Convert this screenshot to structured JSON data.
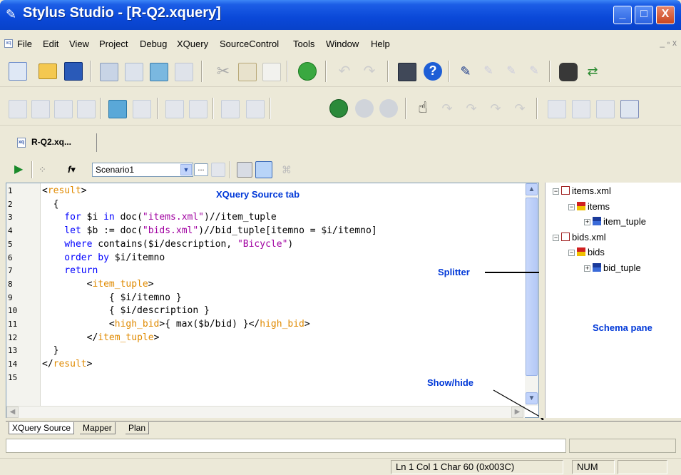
{
  "window": {
    "title": "Stylus Studio - [R-Q2.xquery]",
    "minimize": "_",
    "maximize": "□",
    "close": "X"
  },
  "menu": [
    "File",
    "Edit",
    "View",
    "Project",
    "Debug",
    "XQuery",
    "SourceControl",
    "Tools",
    "Window",
    "Help"
  ],
  "mdi_controls": "_ ▫ x",
  "doc_tab": {
    "label": "R-Q2.xq..."
  },
  "query_toolbar": {
    "scenario": "Scenario1",
    "browse": "..."
  },
  "editor": {
    "line_numbers": [
      "1",
      "2",
      "3",
      "4",
      "5",
      "6",
      "7",
      "8",
      "9",
      "10",
      "11",
      "12",
      "13",
      "14",
      "15"
    ],
    "lines": [
      [
        {
          "t": "<",
          "c": "plain"
        },
        {
          "t": "result",
          "c": "tag"
        },
        {
          "t": ">",
          "c": "plain"
        }
      ],
      [
        {
          "t": "  {",
          "c": "plain"
        }
      ],
      [
        {
          "t": "    for ",
          "c": "kw"
        },
        {
          "t": "$i ",
          "c": "plain"
        },
        {
          "t": "in ",
          "c": "kw"
        },
        {
          "t": "doc(",
          "c": "plain"
        },
        {
          "t": "\"items.xml\"",
          "c": "str"
        },
        {
          "t": ")//item_tuple",
          "c": "plain"
        }
      ],
      [
        {
          "t": "    let ",
          "c": "kw"
        },
        {
          "t": "$b := doc(",
          "c": "plain"
        },
        {
          "t": "\"bids.xml\"",
          "c": "str"
        },
        {
          "t": ")//bid_tuple[itemno = $i/itemno]",
          "c": "plain"
        }
      ],
      [
        {
          "t": "    where ",
          "c": "kw"
        },
        {
          "t": "contains($i/description, ",
          "c": "plain"
        },
        {
          "t": "\"Bicycle\"",
          "c": "str"
        },
        {
          "t": ")",
          "c": "plain"
        }
      ],
      [
        {
          "t": "    order by ",
          "c": "kw"
        },
        {
          "t": "$i/itemno",
          "c": "plain"
        }
      ],
      [
        {
          "t": "    return",
          "c": "kw"
        }
      ],
      [
        {
          "t": "        <",
          "c": "plain"
        },
        {
          "t": "item_tuple",
          "c": "tag"
        },
        {
          "t": ">",
          "c": "plain"
        }
      ],
      [
        {
          "t": "            { $i/itemno }",
          "c": "plain"
        }
      ],
      [
        {
          "t": "            { $i/description }",
          "c": "plain"
        }
      ],
      [
        {
          "t": "            <",
          "c": "plain"
        },
        {
          "t": "high_bid",
          "c": "tag"
        },
        {
          "t": ">{ max($b/bid) }</",
          "c": "plain"
        },
        {
          "t": "high_bid",
          "c": "tag"
        },
        {
          "t": ">",
          "c": "plain"
        }
      ],
      [
        {
          "t": "        </",
          "c": "plain"
        },
        {
          "t": "item_tuple",
          "c": "tag"
        },
        {
          "t": ">",
          "c": "plain"
        }
      ],
      [
        {
          "t": "  }",
          "c": "plain"
        }
      ],
      [
        {
          "t": "</",
          "c": "plain"
        },
        {
          "t": "result",
          "c": "tag"
        },
        {
          "t": ">",
          "c": "plain"
        }
      ],
      []
    ]
  },
  "schema_tree": [
    {
      "label": "items.xml",
      "icon": "xml-doc",
      "exp": "−",
      "indent": 0
    },
    {
      "label": "items",
      "icon": "element",
      "exp": "−",
      "indent": 1
    },
    {
      "label": "item_tuple",
      "icon": "element-group",
      "exp": "+",
      "indent": 2
    },
    {
      "label": "bids.xml",
      "icon": "xml-doc",
      "exp": "−",
      "indent": 0
    },
    {
      "label": "bids",
      "icon": "element",
      "exp": "−",
      "indent": 1
    },
    {
      "label": "bid_tuple",
      "icon": "element-group",
      "exp": "+",
      "indent": 2
    }
  ],
  "annotations": {
    "xquery_source_tab": "XQuery Source tab",
    "splitter": "Splitter",
    "schema_pane": "Schema pane",
    "show_hide": "Show/hide"
  },
  "view_tabs": [
    "XQuery Source",
    "Mapper",
    "Plan"
  ],
  "status": {
    "position": "Ln 1 Col 1  Char 60 (0x003C)",
    "num": "NUM"
  }
}
